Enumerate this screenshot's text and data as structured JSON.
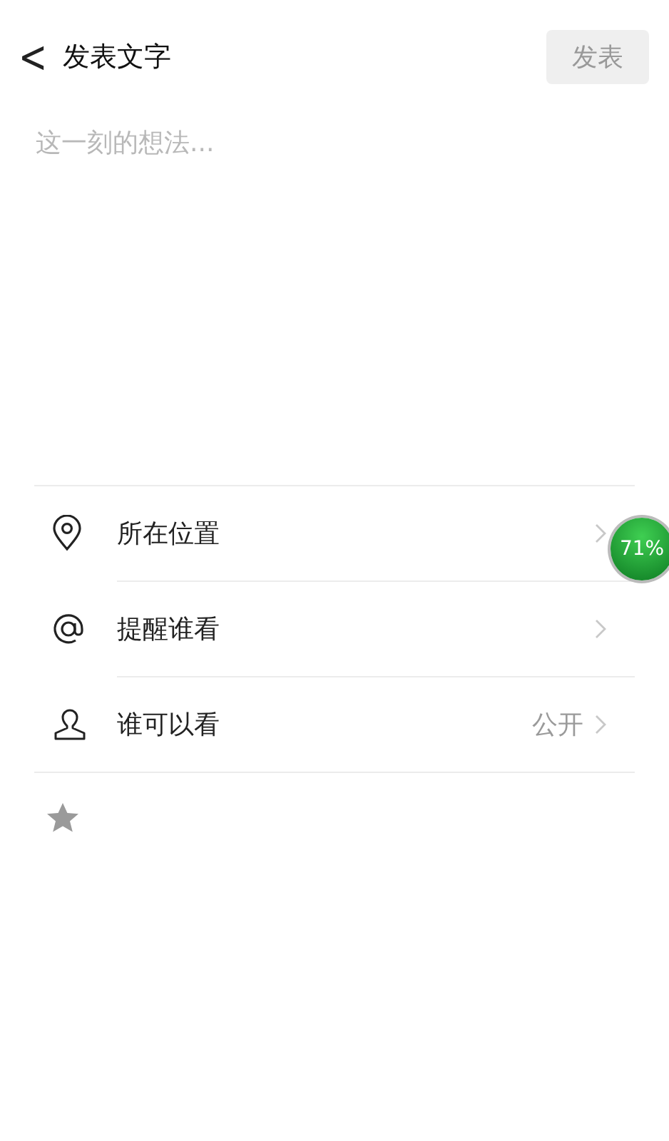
{
  "header": {
    "back": "<",
    "title": "发表文字",
    "post_button": {
      "label": "发表",
      "disabled": true
    }
  },
  "composer": {
    "placeholder": "这一刻的想法..."
  },
  "options": [
    {
      "kind": "location",
      "label": "所在位置"
    },
    {
      "kind": "mention",
      "label": "提醒谁看"
    },
    {
      "kind": "audience",
      "label": "谁可以看",
      "value": "公开"
    }
  ],
  "floating_badge": {
    "text": "71%"
  }
}
